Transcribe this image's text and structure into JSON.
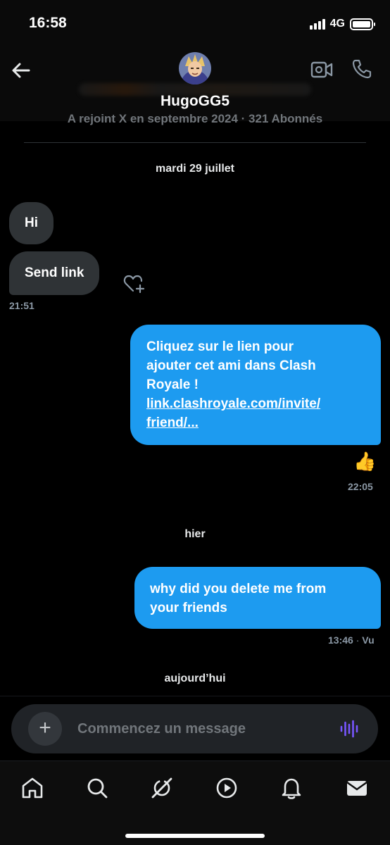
{
  "status_bar": {
    "time": "16:58",
    "network": "4G"
  },
  "header": {
    "name": "HugoGG5",
    "joined_text": "A rejoint X en septembre 2024 · 321 Abonnés"
  },
  "conversation": [
    {
      "type": "date",
      "label": "mardi 29 juillet"
    },
    {
      "type": "incoming",
      "text": "Hi"
    },
    {
      "type": "incoming",
      "text": "Send link",
      "time": "21:51"
    },
    {
      "type": "outgoing",
      "lines": [
        "Cliquez sur le lien pour",
        "ajouter cet ami dans Clash",
        "Royale !"
      ],
      "link_lines": [
        "link.clashroyale.com/invite/",
        "friend/..."
      ],
      "reaction": "👍",
      "time": "22:05"
    },
    {
      "type": "date",
      "label": "hier"
    },
    {
      "type": "outgoing",
      "lines": [
        "why did you delete me from",
        "your friends"
      ],
      "time": "13:46",
      "status": "Vu"
    },
    {
      "type": "date",
      "label": "aujourd’hui"
    }
  ],
  "composer": {
    "placeholder": "Commencez un message"
  },
  "colors": {
    "accent": "#1d9bf0",
    "incoming_bubble": "#2f3336",
    "voice": "#7856ff"
  },
  "icons": {
    "header": [
      "back-arrow-icon",
      "video-call-icon",
      "phone-icon"
    ],
    "tabs": [
      "home-icon",
      "search-icon",
      "grok-icon",
      "video-play-icon",
      "bell-icon",
      "mail-icon"
    ]
  }
}
